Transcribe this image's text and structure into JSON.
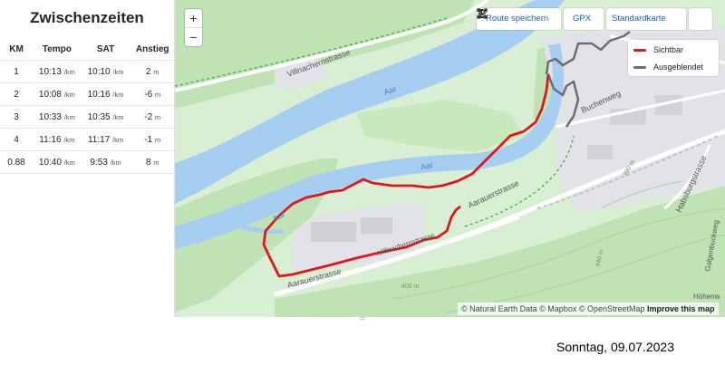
{
  "splits": {
    "title": "Zwischenzeiten",
    "columns": [
      "KM",
      "Tempo",
      "SAT",
      "Anstieg"
    ],
    "rows": [
      {
        "km": "1",
        "pace": "10:13",
        "pace_unit": "/km",
        "sat": "10:10",
        "sat_unit": "/km",
        "elev": "2",
        "elev_unit": "m"
      },
      {
        "km": "2",
        "pace": "10:08",
        "pace_unit": "/km",
        "sat": "10:16",
        "sat_unit": "/km",
        "elev": "-6",
        "elev_unit": "m"
      },
      {
        "km": "3",
        "pace": "10:33",
        "pace_unit": "/km",
        "sat": "10:35",
        "sat_unit": "/km",
        "elev": "-2",
        "elev_unit": "m"
      },
      {
        "km": "4",
        "pace": "11:16",
        "pace_unit": "/km",
        "sat": "11:17",
        "sat_unit": "/km",
        "elev": "-1",
        "elev_unit": "m"
      },
      {
        "km": "0.88",
        "pace": "10:40",
        "pace_unit": "/km",
        "sat": "9:53",
        "sat_unit": "/km",
        "elev": "8",
        "elev_unit": "m"
      }
    ]
  },
  "map": {
    "zoom_in": "+",
    "zoom_out": "−",
    "toolbar": {
      "route_label": "Route speichern",
      "route_icon": "route-icon",
      "gpx_label": "GPX",
      "gpx_icon": "download-icon",
      "style_label": "Standardkarte",
      "style_icon": "caret-down-icon",
      "fullscreen_icon": "fullscreen-icon"
    },
    "legend": {
      "visible_label": "Sichtbar",
      "visible_color": "#e0161b",
      "hidden_label": "Ausgeblendet",
      "hidden_color": "#6e6e6e"
    },
    "labels": {
      "villnachern": "Villnachernstrasse",
      "aar1": "Aar",
      "aar2": "Aar",
      "aar3": "Aar",
      "aarauer1": "Aarauerstrasse",
      "aarauer2": "Aarauerstrasse",
      "buchenweg": "Buchenweg",
      "habsburg": "Habsburgstrasse",
      "galgen": "Galgenbuckweg",
      "hohen": "Höhenw",
      "villnachern2": "Villnachernstrasse",
      "contour390": "390 m",
      "contour440": "440 m",
      "contour400": "400 m"
    },
    "attribution": {
      "text": "© Natural Earth Data © Mapbox © OpenStreetMap",
      "improve": "Improve this map"
    },
    "colors": {
      "forest": "#bfe3b4",
      "meadow": "#d9efd3",
      "river": "#a6cef0",
      "urban": "#e2e3e8",
      "route": "#e0161b",
      "hidden": "#6e6e6e"
    }
  },
  "footer": {
    "date": "Sonntag, 09.07.2023"
  }
}
